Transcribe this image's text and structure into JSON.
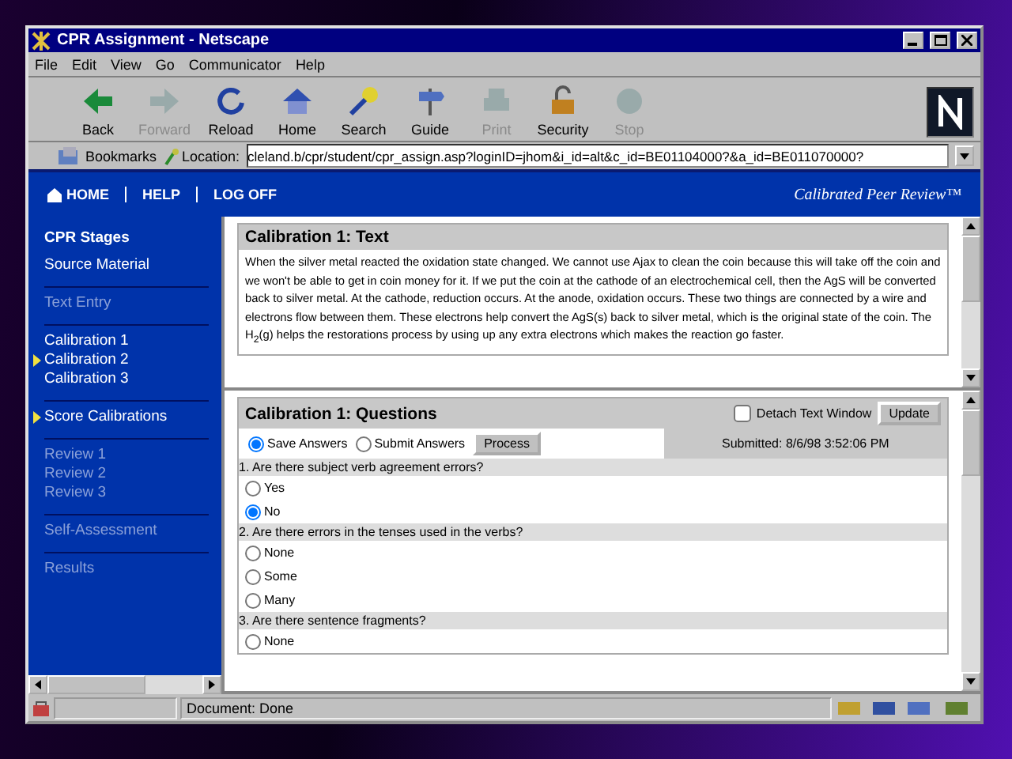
{
  "window": {
    "title": "CPR Assignment - Netscape"
  },
  "menu": [
    "File",
    "Edit",
    "View",
    "Go",
    "Communicator",
    "Help"
  ],
  "toolbar": [
    {
      "kind": "back",
      "label": "Back",
      "disabled": false
    },
    {
      "kind": "forward",
      "label": "Forward",
      "disabled": true
    },
    {
      "kind": "reload",
      "label": "Reload",
      "disabled": false
    },
    {
      "kind": "home",
      "label": "Home",
      "disabled": false
    },
    {
      "kind": "search",
      "label": "Search",
      "disabled": false
    },
    {
      "kind": "guide",
      "label": "Guide",
      "disabled": false
    },
    {
      "kind": "print",
      "label": "Print",
      "disabled": true
    },
    {
      "kind": "security",
      "label": "Security",
      "disabled": false
    },
    {
      "kind": "stop",
      "label": "Stop",
      "disabled": true
    }
  ],
  "location_bar": {
    "bookmarks": "Bookmarks",
    "label": "Location:",
    "url": "cleland.b/cpr/student/cpr_assign.asp?loginID=jhom&i_id=alt&c_id=BE01104000?&a_id=BE011070000?"
  },
  "header": {
    "links": [
      "HOME",
      "HELP",
      "LOG OFF"
    ],
    "brand": "Calibrated Peer Review™"
  },
  "sidebar": {
    "title": "CPR Stages",
    "groups": [
      [
        {
          "label": "Source Material",
          "disabled": false,
          "current": false
        }
      ],
      [
        {
          "label": "Text Entry",
          "disabled": true,
          "current": false
        }
      ],
      [
        {
          "label": "Calibration 1",
          "disabled": false,
          "current": false
        },
        {
          "label": "Calibration 2",
          "disabled": false,
          "current": true
        },
        {
          "label": "Calibration 3",
          "disabled": false,
          "current": false
        }
      ],
      [
        {
          "label": "Score Calibrations",
          "disabled": false,
          "current": true
        }
      ],
      [
        {
          "label": "Review 1",
          "disabled": true,
          "current": false
        },
        {
          "label": "Review 2",
          "disabled": true,
          "current": false
        },
        {
          "label": "Review 3",
          "disabled": true,
          "current": false
        }
      ],
      [
        {
          "label": "Self-Assessment",
          "disabled": true,
          "current": false
        }
      ],
      [
        {
          "label": "Results",
          "disabled": true,
          "current": false
        }
      ]
    ]
  },
  "text_panel": {
    "title": "Calibration 1: Text",
    "body": "When the silver metal reacted the oxidation state changed. We cannot use Ajax to clean the coin because this will take off the coin and we won't be able to get in coin money for it. If we put the coin at the cathode of an electrochemical cell, then the AgS will be converted back to silver metal. At the cathode, reduction occurs. At the anode, oxidation occurs. These two things are connected by a wire and electrons flow between them. These electrons help convert the AgS(s) back to silver metal, which is the original state of the coin. The H$_{2}$(g) helps the restorations process by using up any extra electrons which makes the reaction go faster."
  },
  "questions_panel": {
    "title": "Calibration 1: Questions",
    "detach": {
      "label": "Detach Text Window",
      "checked": false
    },
    "update_button": "Update",
    "modes": [
      {
        "label": "Save Answers",
        "selected": true
      },
      {
        "label": "Submit Answers",
        "selected": false
      }
    ],
    "process_button": "Process",
    "submitted": "Submitted: 8/6/98 3:52:06 PM",
    "questions": [
      {
        "text": "1. Are there subject verb agreement errors?",
        "options": [
          {
            "label": "Yes",
            "selected": false
          },
          {
            "label": "No",
            "selected": true
          }
        ]
      },
      {
        "text": "2. Are there errors in the tenses used in the verbs?",
        "options": [
          {
            "label": "None",
            "selected": false
          },
          {
            "label": "Some",
            "selected": false
          },
          {
            "label": "Many",
            "selected": false
          }
        ]
      },
      {
        "text": "3. Are there sentence fragments?",
        "options": [
          {
            "label": "None",
            "selected": false
          }
        ]
      }
    ]
  },
  "status_bar": {
    "text": "Document: Done"
  }
}
